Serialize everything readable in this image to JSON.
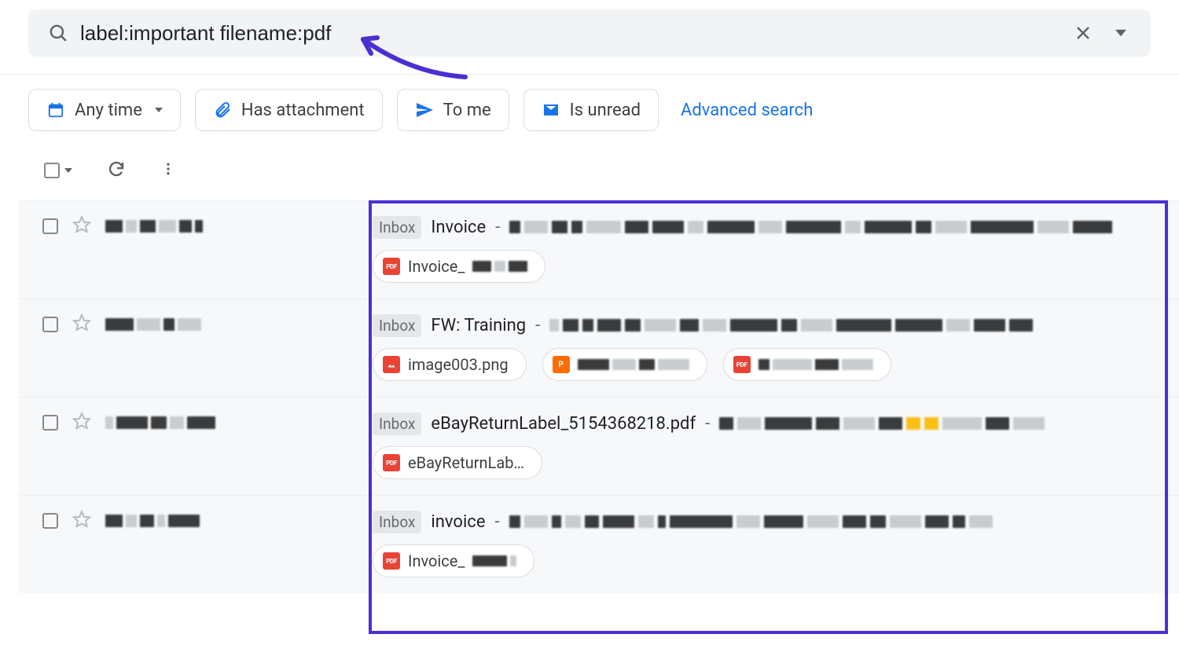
{
  "search": {
    "query": "label:important filename:pdf"
  },
  "filters": {
    "any_time": "Any time",
    "has_attachment": "Has attachment",
    "to_me": "To me",
    "is_unread": "Is unread",
    "advanced": "Advanced search"
  },
  "label_inbox": "Inbox",
  "rows": [
    {
      "subject": "Invoice",
      "attachments": [
        {
          "type": "pdf",
          "name": "Invoice_"
        }
      ]
    },
    {
      "subject": "FW: Training",
      "attachments": [
        {
          "type": "img",
          "name": "image003.png"
        },
        {
          "type": "ppt",
          "name": ""
        },
        {
          "type": "pdf",
          "name": ""
        }
      ]
    },
    {
      "subject": "eBayReturnLabel_5154368218.pdf",
      "attachments": [
        {
          "type": "pdf",
          "name": "eBayReturnLab…"
        }
      ]
    },
    {
      "subject": "invoice",
      "attachments": [
        {
          "type": "pdf",
          "name": "Invoice_"
        }
      ]
    }
  ]
}
